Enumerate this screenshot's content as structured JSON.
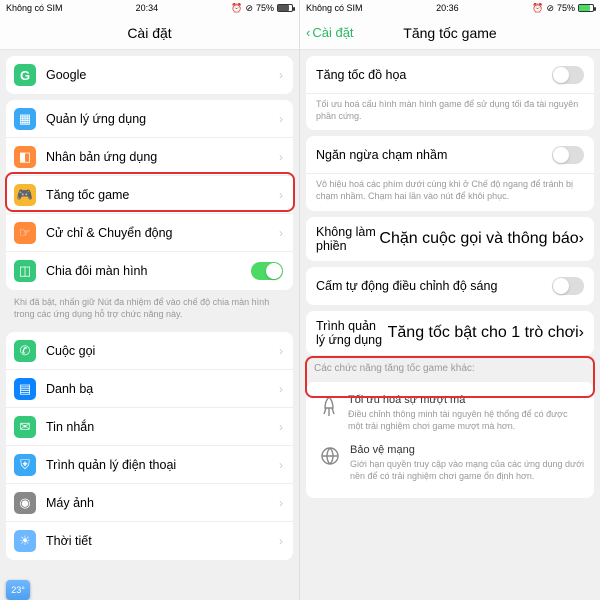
{
  "left": {
    "status": {
      "sim": "Không có SIM",
      "time": "20:34",
      "battery_pct": "75%",
      "battery_fill": "75%"
    },
    "title": "Cài đặt",
    "rows": {
      "google": "Google",
      "apps": "Quản lý ứng dụng",
      "clone": "Nhân bản ứng dụng",
      "game": "Tăng tốc game",
      "gesture": "Cử chỉ & Chuyển động",
      "split": "Chia đôi màn hình"
    },
    "hint": "Khi đã bật, nhấn giữ Nút đa nhiệm để vào chế độ chia màn hình trong các ứng dụng hỗ trợ chức năng này.",
    "rows2": {
      "call": "Cuộc gọi",
      "contacts": "Danh bạ",
      "sms": "Tin nhắn",
      "pmgr": "Trình quản lý điện thoại",
      "camera": "Máy ảnh",
      "weather": "Thời tiết"
    },
    "widget": "23"
  },
  "right": {
    "status": {
      "sim": "Không có SIM",
      "time": "20:36",
      "battery_pct": "75%",
      "battery_fill": "75%"
    },
    "back": "Cài đặt",
    "title": "Tăng tốc game",
    "r1": {
      "label": "Tăng tốc đồ họa",
      "desc": "Tối ưu hoá cấu hình màn hình game để sử dụng tối đa tài nguyên phần cứng."
    },
    "r2": {
      "label": "Ngăn ngừa chạm nhầm",
      "desc": "Vô hiệu hoá các phím dưới cùng khi ở Chế độ ngang để tránh bị chạm nhầm. Chạm hai lần vào nút để khôi phục."
    },
    "r3": {
      "label": "Không làm phiền",
      "sub": "Chặn cuộc gọi và thông báo"
    },
    "r4": {
      "label": "Cấm tự động điều chỉnh độ sáng"
    },
    "r5": {
      "label": "Trình quản lý ứng dụng",
      "sub": "Tăng tốc bật cho 1 trò chơi"
    },
    "other_head": "Các chức năng tăng tốc game khác:",
    "feat1": {
      "title": "Tối ưu hoá sự mượt mà",
      "desc": "Điều chỉnh thông minh tài nguyên hệ thống để có được một trải nghiệm chơi game mượt mà hơn."
    },
    "feat2": {
      "title": "Bảo vệ mạng",
      "desc": "Giới hạn quyền truy cập vào mạng của các ứng dụng dưới nền để có trải nghiệm chơi game ổn định hơn."
    }
  }
}
